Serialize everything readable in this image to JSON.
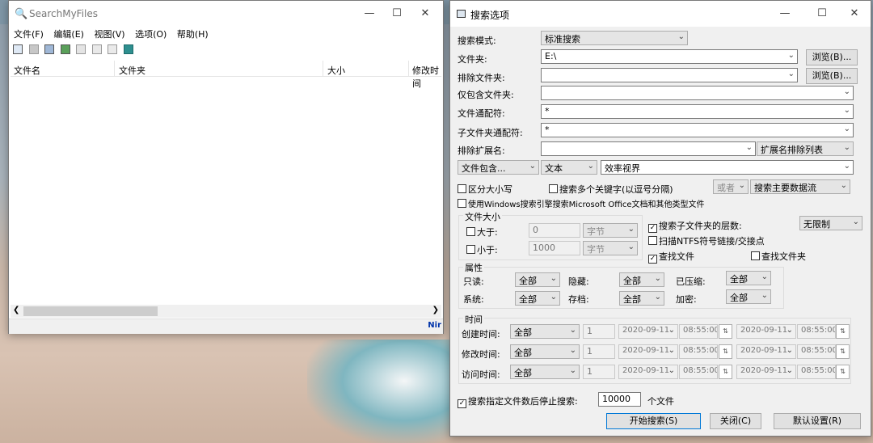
{
  "searchmyfiles": {
    "title": "SearchMyFiles",
    "menu": [
      "文件(F)",
      "编辑(E)",
      "视图(V)",
      "选项(O)",
      "帮助(H)"
    ],
    "columns": [
      "文件名",
      "文件夹",
      "大小",
      "修改时间"
    ],
    "status_logo": "Nir"
  },
  "dialog": {
    "title": "搜索选项",
    "search_mode_label": "搜索模式:",
    "search_mode_value": "标准搜索",
    "folder_label": "文件夹:",
    "folder_value": "E:\\",
    "browse1": "浏览(B)...",
    "exclude_folder_label": "排除文件夹:",
    "exclude_folder_value": "",
    "browse2": "浏览(B)...",
    "include_only_label": "仅包含文件夹:",
    "include_only_value": "",
    "wildcard_label": "文件通配符:",
    "wildcard_value": "*",
    "subfolder_wildcard_label": "子文件夹通配符:",
    "subfolder_wildcard_value": "*",
    "exclude_ext_label": "排除扩展名:",
    "exclude_ext_value": "",
    "ext_list": "扩展名排除列表",
    "contains_combo": "文件包含...",
    "text_combo": "文本",
    "contains_value": "效率视界",
    "case_sensitive": "区分大小写",
    "multi_keywords": "搜索多个关键字(以逗号分隔)",
    "or_combo": "或者",
    "main_stream": "搜索主要数据流",
    "windows_search": "使用Windows搜索引擎搜索Microsoft Office文档和其他类型文件",
    "filesize_group": "文件大小",
    "bigger": "大于:",
    "bigger_value": "0",
    "smaller": "小于:",
    "smaller_value": "1000",
    "unit": "字节",
    "subfolder_depth": "搜索子文件夹的层数:",
    "depth_value": "无限制",
    "scan_ntfs": "扫描NTFS符号链接/交接点",
    "find_files": "查找文件",
    "find_folders": "查找文件夹",
    "attr_group": "属性",
    "readonly": "只读:",
    "hidden": "隐藏:",
    "compressed": "已压缩:",
    "system": "系统:",
    "archive": "存档:",
    "encrypted": "加密:",
    "all": "全部",
    "time_group": "时间",
    "times": [
      {
        "label": "创建时间:",
        "value": "全部",
        "n": "1",
        "date1": "2020-09-11",
        "time1": "08:55:00",
        "date2": "2020-09-11",
        "time2": "08:55:00"
      },
      {
        "label": "修改时间:",
        "value": "全部",
        "n": "1",
        "date1": "2020-09-11",
        "time1": "08:55:00",
        "date2": "2020-09-11",
        "time2": "08:55:00"
      },
      {
        "label": "访问时间:",
        "value": "全部",
        "n": "1",
        "date1": "2020-09-11",
        "time1": "08:55:00",
        "date2": "2020-09-11",
        "time2": "08:55:00"
      }
    ],
    "stop_after": "搜索指定文件数后停止搜索:",
    "stop_value": "10000",
    "files_unit": "个文件",
    "start": "开始搜索(S)",
    "close": "关闭(C)",
    "defaults": "默认设置(R)"
  }
}
